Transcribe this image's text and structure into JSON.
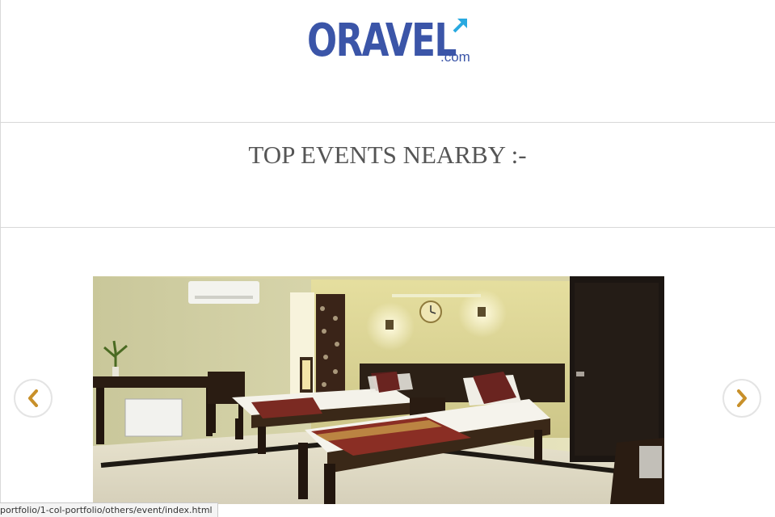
{
  "header": {
    "logo_text": "ORAVEL",
    "logo_suffix": ".com"
  },
  "events": {
    "title": "TOP EVENTS NEARBY :-"
  },
  "carousel": {
    "prev_icon": "chevron-left",
    "next_icon": "chevron-right",
    "accent_color": "#c8902a"
  },
  "status_bar": {
    "url": "portfolio/1-col-portfolio/others/event/index.html"
  },
  "colors": {
    "brand": "#3b55a8",
    "arrow": "#29a9e0"
  }
}
